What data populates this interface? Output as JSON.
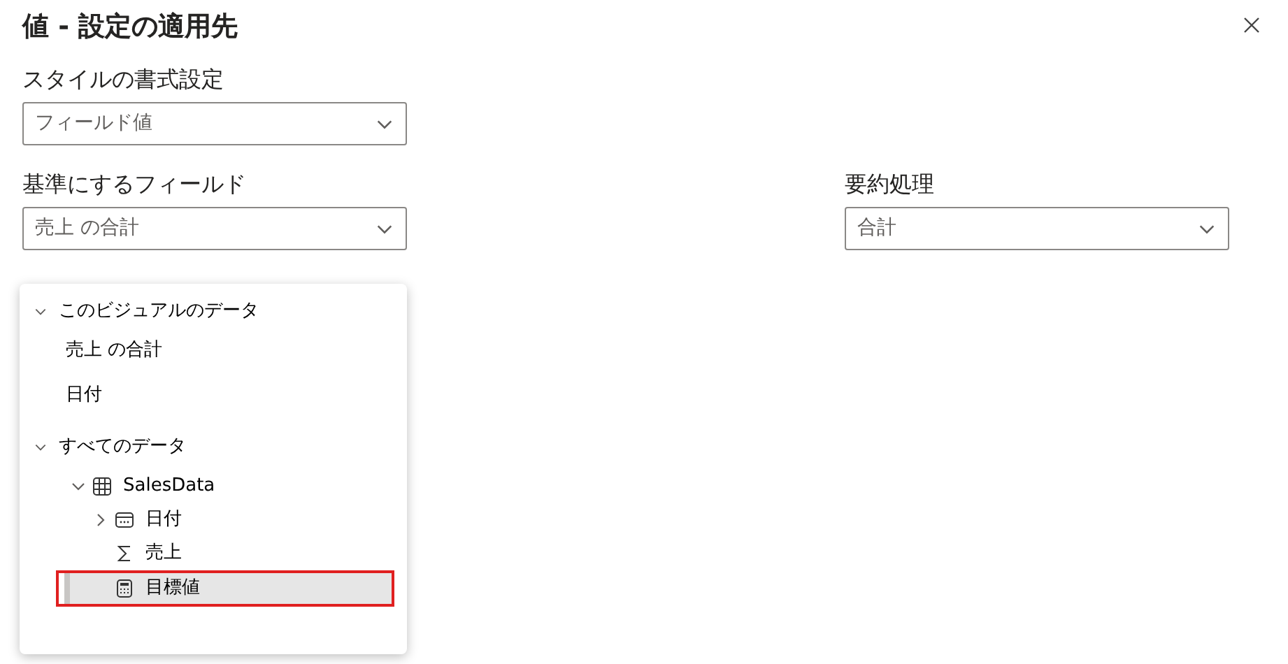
{
  "dialog": {
    "title": "値 - 設定の適用先"
  },
  "format_style": {
    "label": "スタイルの書式設定",
    "value": "フィールド値"
  },
  "base_field": {
    "label": "基準にするフィールド",
    "value": "売上 の合計"
  },
  "summarization": {
    "label": "要約処理",
    "value": "合計"
  },
  "field_menu": {
    "groups": [
      {
        "label": "このビジュアルのデータ",
        "expanded": true,
        "items": [
          {
            "label": "売上 の合計",
            "kind": "plain",
            "selected": false
          },
          {
            "label": "日付",
            "kind": "plain",
            "selected": false
          }
        ]
      },
      {
        "label": "すべてのデータ",
        "expanded": true,
        "items": [
          {
            "label": "SalesData",
            "kind": "table",
            "expanded": true,
            "selected": false,
            "children": [
              {
                "label": "日付",
                "kind": "date",
                "expanded": false,
                "selected": false
              },
              {
                "label": "売上",
                "kind": "measure",
                "selected": false
              },
              {
                "label": "目標値",
                "kind": "calculated",
                "selected": true
              }
            ]
          }
        ]
      }
    ]
  }
}
